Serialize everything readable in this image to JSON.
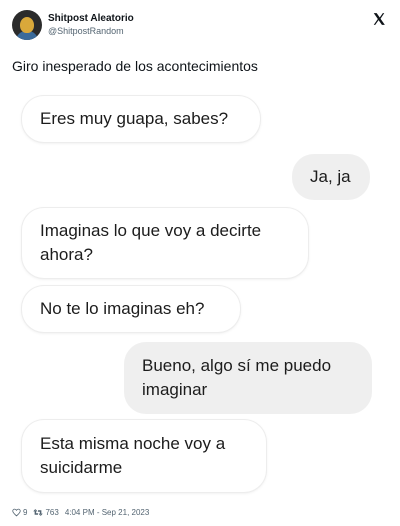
{
  "author": {
    "display_name": "Shitpost Aleatorio",
    "handle": "@ShitpostRandom"
  },
  "tweet": {
    "text": "Giro inesperado de los acontecimientos"
  },
  "messages": [
    {
      "side": "in",
      "text": "Eres muy guapa, sabes?"
    },
    {
      "side": "out",
      "text": "Ja, ja"
    },
    {
      "side": "in",
      "text": "Imaginas lo que voy a decirte ahora?"
    },
    {
      "side": "in",
      "text": "No te lo imaginas eh?"
    },
    {
      "side": "out",
      "text": "Bueno, algo sí me puedo imaginar"
    },
    {
      "side": "in",
      "text": "Esta misma noche voy a suicidarme"
    }
  ],
  "footer": {
    "likes": "9",
    "retweets": "763",
    "timestamp": "4:04 PM - Sep 21, 2023"
  },
  "icons": {
    "logo": "x-logo-icon",
    "like": "heart-icon",
    "retweet": "retweet-icon"
  }
}
